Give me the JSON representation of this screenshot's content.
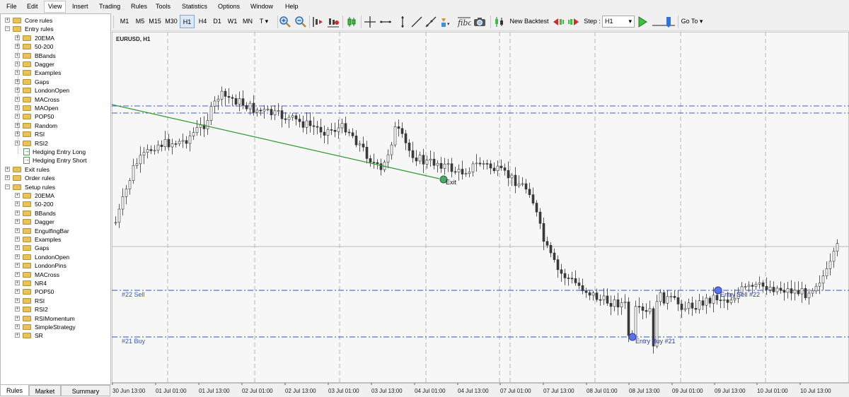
{
  "menu": [
    "File",
    "Edit",
    "View",
    "Insert",
    "Trading",
    "Rules",
    "Tools",
    "Statistics",
    "Options",
    "Window",
    "Help"
  ],
  "menu_active": "View",
  "toolbar": {
    "timeframes": [
      "M1",
      "M5",
      "M15",
      "M30",
      "H1",
      "H4",
      "D1",
      "W1",
      "MN",
      "T ▾"
    ],
    "selected_timeframe": "H1",
    "new_backtest_label": "New Backtest",
    "step_label": "Step :",
    "step_value": "H1",
    "goto_label": "Go To ▾"
  },
  "tree": [
    {
      "label": "Core rules",
      "type": "folder",
      "level": 0,
      "exp": "+"
    },
    {
      "label": "Entry rules",
      "type": "folder",
      "level": 0,
      "exp": "-"
    },
    {
      "label": "20EMA",
      "type": "folder",
      "level": 1,
      "exp": "+"
    },
    {
      "label": "50-200",
      "type": "folder",
      "level": 1,
      "exp": "+"
    },
    {
      "label": "BBands",
      "type": "folder",
      "level": 1,
      "exp": "+"
    },
    {
      "label": "Dagger",
      "type": "folder",
      "level": 1,
      "exp": "+"
    },
    {
      "label": "Examples",
      "type": "folder",
      "level": 1,
      "exp": "+"
    },
    {
      "label": "Gaps",
      "type": "folder",
      "level": 1,
      "exp": "+"
    },
    {
      "label": "LondonOpen",
      "type": "folder",
      "level": 1,
      "exp": "+"
    },
    {
      "label": "MACross",
      "type": "folder",
      "level": 1,
      "exp": "+"
    },
    {
      "label": "MAOpen",
      "type": "folder",
      "level": 1,
      "exp": "+"
    },
    {
      "label": "POP50",
      "type": "folder",
      "level": 1,
      "exp": "+"
    },
    {
      "label": "Random",
      "type": "folder",
      "level": 1,
      "exp": "+"
    },
    {
      "label": "RSI",
      "type": "folder",
      "level": 1,
      "exp": "+"
    },
    {
      "label": "RSI2",
      "type": "folder",
      "level": 1,
      "exp": "+"
    },
    {
      "label": "Hedging Entry Long",
      "type": "rule",
      "level": 2,
      "exp": ""
    },
    {
      "label": "Hedging Entry Short",
      "type": "rule",
      "level": 2,
      "exp": ""
    },
    {
      "label": "Exit rules",
      "type": "folder",
      "level": 0,
      "exp": "+"
    },
    {
      "label": "Order rules",
      "type": "folder",
      "level": 0,
      "exp": "+"
    },
    {
      "label": "Setup rules",
      "type": "folder",
      "level": 0,
      "exp": "-"
    },
    {
      "label": "20EMA",
      "type": "folder",
      "level": 1,
      "exp": "+"
    },
    {
      "label": "50-200",
      "type": "folder",
      "level": 1,
      "exp": "+"
    },
    {
      "label": "BBands",
      "type": "folder",
      "level": 1,
      "exp": "+"
    },
    {
      "label": "Dagger",
      "type": "folder",
      "level": 1,
      "exp": "+"
    },
    {
      "label": "EngulfingBar",
      "type": "folder",
      "level": 1,
      "exp": "+"
    },
    {
      "label": "Examples",
      "type": "folder",
      "level": 1,
      "exp": "+"
    },
    {
      "label": "Gaps",
      "type": "folder",
      "level": 1,
      "exp": "+"
    },
    {
      "label": "LondonOpen",
      "type": "folder",
      "level": 1,
      "exp": "+"
    },
    {
      "label": "LondonPins",
      "type": "folder",
      "level": 1,
      "exp": "+"
    },
    {
      "label": "MACross",
      "type": "folder",
      "level": 1,
      "exp": "+"
    },
    {
      "label": "NR4",
      "type": "folder",
      "level": 1,
      "exp": "+"
    },
    {
      "label": "POP50",
      "type": "folder",
      "level": 1,
      "exp": "+"
    },
    {
      "label": "RSI",
      "type": "folder",
      "level": 1,
      "exp": "+"
    },
    {
      "label": "RSI2",
      "type": "folder",
      "level": 1,
      "exp": "+"
    },
    {
      "label": "RSIMomentum",
      "type": "folder",
      "level": 1,
      "exp": "+"
    },
    {
      "label": "SimpleStrategy",
      "type": "folder",
      "level": 1,
      "exp": "+"
    },
    {
      "label": "SR",
      "type": "folder",
      "level": 1,
      "exp": "+"
    }
  ],
  "tabs": [
    "Rules",
    "Market",
    "Summary"
  ],
  "tab_active": "Rules",
  "chart": {
    "symbol_title": "EURUSD, H1",
    "x_labels": [
      "30 Jun 13:00",
      "01 Jul 01:00",
      "01 Jul 13:00",
      "02 Jul 01:00",
      "02 Jul 13:00",
      "03 Jul 01:00",
      "03 Jul 13:00",
      "04 Jul 01:00",
      "04 Jul 13:00",
      "07 Jul 01:00",
      "07 Jul 13:00",
      "08 Jul 01:00",
      "08 Jul 13:00",
      "09 Jul 01:00",
      "09 Jul 13:00",
      "10 Jul 01:00",
      "10 Jul 13:00"
    ],
    "annotations": {
      "sell_label": "#22 Sell",
      "buy_label": "#21 Buy",
      "exit_label": "Exit",
      "entry_buy_label": "Entry Buy #21",
      "entry_sell_label": "Entry Sell #22"
    },
    "colors": {
      "bull": "#ffffff",
      "bear": "#3a3a3a",
      "trade_line": "#2255cc",
      "trendline": "#2e9a2e",
      "grid": "#b5b5b5",
      "marker": "#5a73e8"
    }
  }
}
